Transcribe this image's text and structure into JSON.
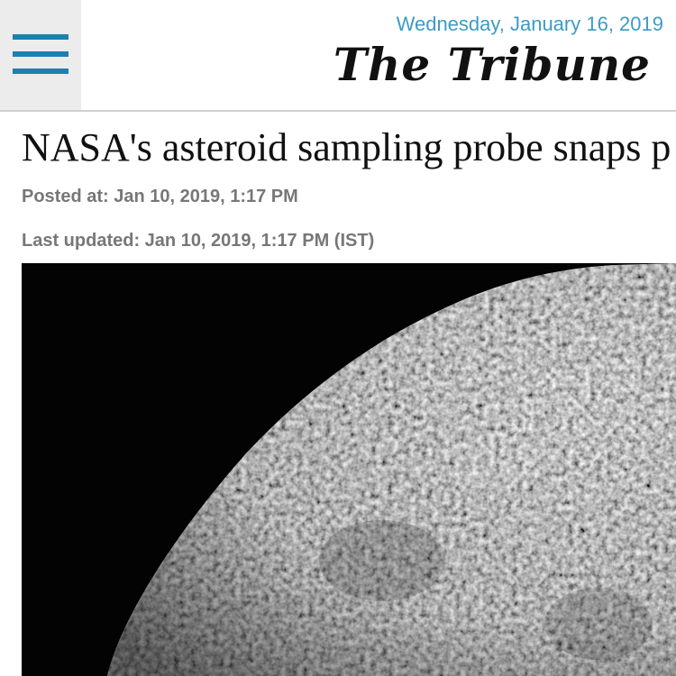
{
  "header": {
    "menu_icon": "hamburger-menu-icon",
    "date": "Wednesday, January 16, 2019",
    "masthead": "The Tribune",
    "accent_color": "#3b9cc4",
    "menu_color": "#1f7fb0"
  },
  "article": {
    "headline": "NASA's asteroid sampling probe snaps p",
    "posted": "Posted at: Jan 10, 2019, 1:17 PM",
    "updated": "Last updated: Jan 10, 2019, 1:17 PM (IST)",
    "image_subject": "asteroid-surface"
  }
}
